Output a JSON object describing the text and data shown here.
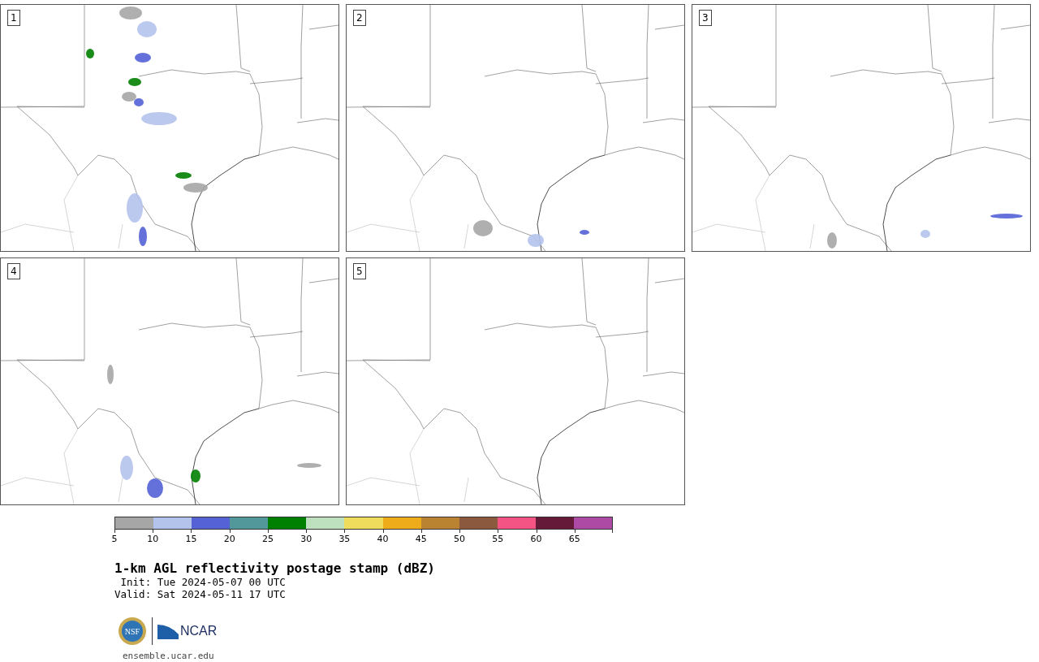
{
  "panels": [
    {
      "label": "1"
    },
    {
      "label": "2"
    },
    {
      "label": "3"
    },
    {
      "label": "4"
    },
    {
      "label": "5"
    }
  ],
  "colorbar": {
    "bins": [
      {
        "color": "#a6a6a6"
      },
      {
        "color": "#b4c3ec"
      },
      {
        "color": "#5462d6"
      },
      {
        "color": "#52979a"
      },
      {
        "color": "#008000"
      },
      {
        "color": "#bfe0bf"
      },
      {
        "color": "#f0dc5c"
      },
      {
        "color": "#efac1a"
      },
      {
        "color": "#b98331"
      },
      {
        "color": "#8b5a3e"
      },
      {
        "color": "#f45483"
      },
      {
        "color": "#661a39"
      },
      {
        "color": "#ad4aa6"
      }
    ],
    "ticks": [
      "5",
      "10",
      "15",
      "20",
      "25",
      "30",
      "35",
      "40",
      "45",
      "50",
      "55",
      "60",
      "65"
    ]
  },
  "title": "1-km AGL reflectivity postage stamp (dBZ)",
  "init": " Init: Tue 2024-05-07 00 UTC",
  "valid": "Valid: Sat 2024-05-11 17 UTC",
  "logo": {
    "nsf": "NSF",
    "ncar": "NCAR"
  },
  "footer": "ensemble.ucar.edu"
}
